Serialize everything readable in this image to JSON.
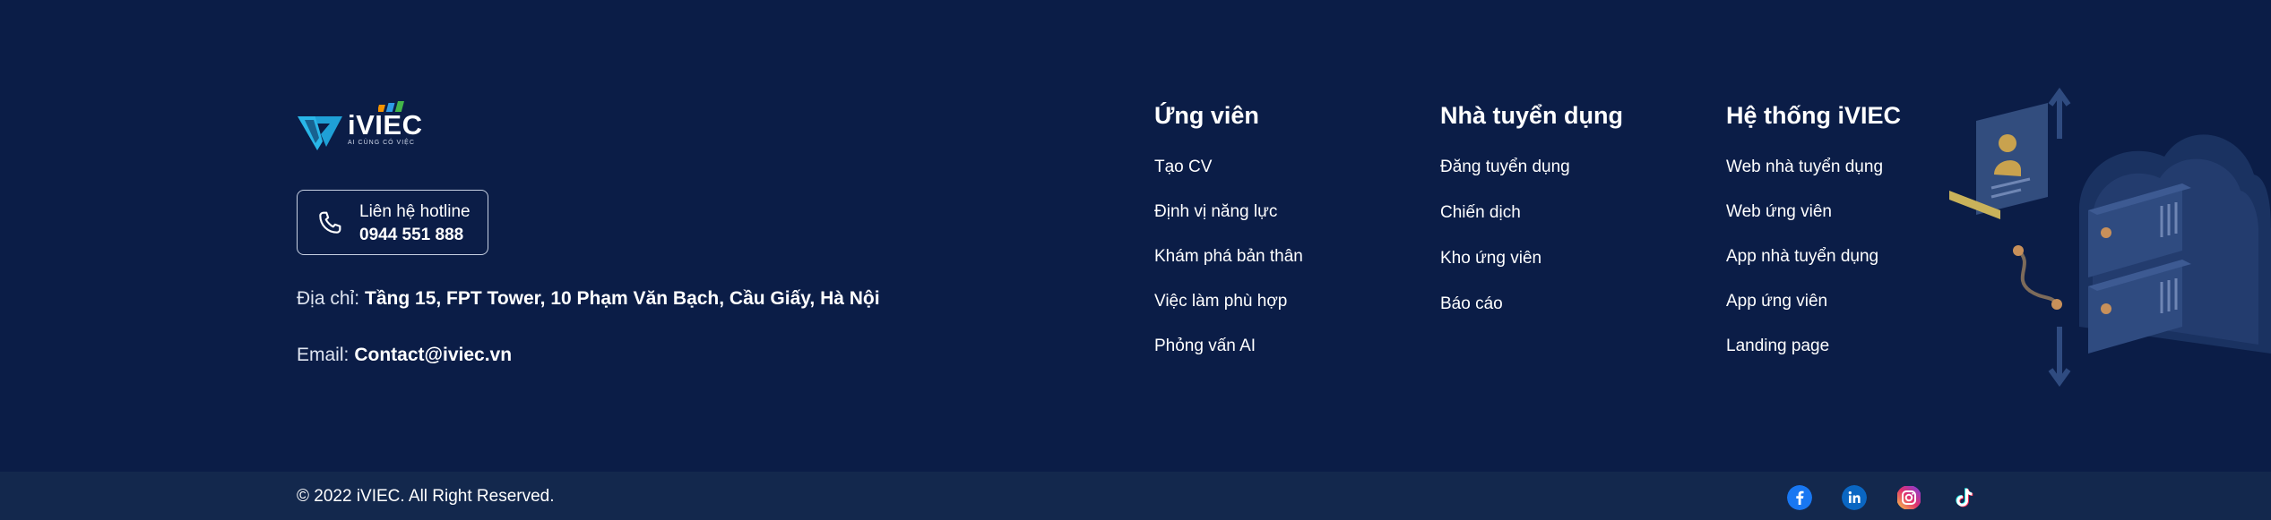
{
  "brand": {
    "logo_text": "iVIEC",
    "logo_tagline": "AI CÙNG CÓ VIỆC"
  },
  "contact": {
    "hotline_label": "Liên hệ hotline",
    "hotline_number": "0944 551 888",
    "address_label": "Địa chỉ:",
    "address_value": "Tầng 15, FPT Tower, 10 Phạm Văn Bạch, Cầu Giấy, Hà Nội",
    "email_label": "Email:",
    "email_value": "Contact@iviec.vn"
  },
  "columns": [
    {
      "title": "Ứng viên",
      "links": [
        "Tạo CV",
        "Định vị năng lực",
        "Khám phá bản thân",
        "Việc làm phù hợp",
        "Phỏng vấn AI"
      ]
    },
    {
      "title": "Nhà tuyển dụng",
      "links": [
        "Đăng tuyển dụng",
        "Chiến dịch",
        "Kho ứng viên",
        "Báo cáo"
      ]
    },
    {
      "title": "Hệ thống iVIEC",
      "links": [
        "Web nhà tuyển dụng",
        "Web ứng viên",
        "App nhà tuyển dụng",
        "App ứng viên",
        "Landing page"
      ]
    }
  ],
  "bottom": {
    "copyright": "© 2022 iVIEC. All Right Reserved.",
    "social": [
      "facebook-icon",
      "linkedin-icon",
      "instagram-icon",
      "tiktok-icon"
    ]
  },
  "colors": {
    "background": "#0b1d47",
    "bottom_bar": "#13284d",
    "logo_accent": "#29b6e8",
    "facebook": "#1877f2",
    "linkedin": "#0a66c2"
  }
}
